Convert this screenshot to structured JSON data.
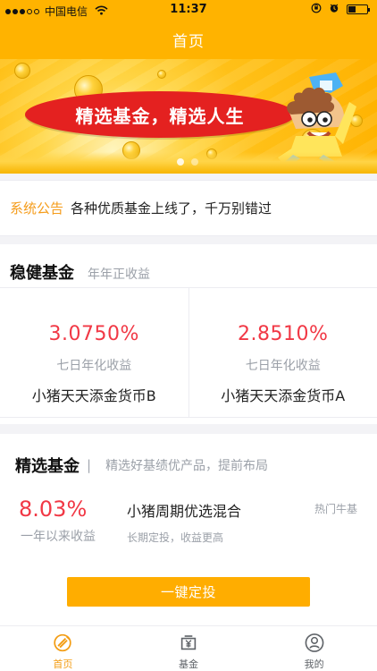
{
  "status": {
    "carrier": "中国电信",
    "time": "11:37",
    "battery_level": 0.38
  },
  "nav": {
    "title": "首页"
  },
  "banner": {
    "slogan": "精选基金，精选人生",
    "active_slide": 1,
    "slide_count": 2
  },
  "notice": {
    "label": "系统公告",
    "text": "各种优质基金上线了，千万别错过"
  },
  "stable_funds": {
    "title": "稳健基金",
    "subtitle": "年年正收益",
    "cards": [
      {
        "rate": "3.0750%",
        "rate_label": "七日年化收益",
        "name": "小猪天天添金货币B"
      },
      {
        "rate": "2.8510%",
        "rate_label": "七日年化收益",
        "name": "小猪天天添金货币A"
      }
    ]
  },
  "selected_funds": {
    "title": "精选基金",
    "divider": "|",
    "subtitle": "精选好基绩优产品，提前布局",
    "rate": "8.03%",
    "rate_label": "一年以来收益",
    "name": "小猪周期优选混合",
    "description": "长期定投，收益更高",
    "tag": "热门牛基",
    "button_label": "一键定投"
  },
  "tabs": [
    {
      "label": "首页",
      "icon": "home-coin-icon",
      "active": true
    },
    {
      "label": "基金",
      "icon": "yen-wallet-icon",
      "active": false
    },
    {
      "label": "我的",
      "icon": "profile-icon",
      "active": false
    }
  ],
  "colors": {
    "accent": "#ffb300",
    "highlight": "#f13845",
    "notice": "#f59c1a",
    "text_muted": "#9ba0a8",
    "button": "#ffad00",
    "active_tab": "#f39c12"
  }
}
